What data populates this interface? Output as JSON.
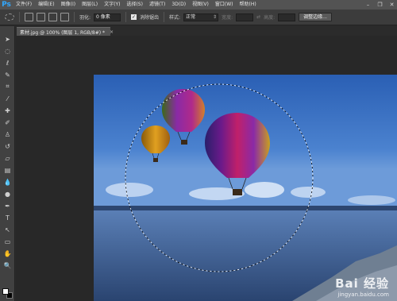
{
  "app": {
    "logo": "Ps"
  },
  "menu": {
    "items": [
      "文件(F)",
      "编辑(E)",
      "图像(I)",
      "图层(L)",
      "文字(Y)",
      "选择(S)",
      "滤镜(T)",
      "3D(D)",
      "视图(V)",
      "窗口(W)",
      "帮助(H)"
    ]
  },
  "window_controls": {
    "minimize": "–",
    "restore": "❐",
    "close": "✕"
  },
  "options": {
    "feather_label": "羽化:",
    "feather_value": "0 像素",
    "antialias_label": "消除锯齿",
    "antialias_checked": true,
    "style_label": "样式:",
    "style_value": "正常",
    "width_label": "宽度:",
    "height_label": "高度:",
    "refine_edge_button": "调整边缘..."
  },
  "document": {
    "tab_title": "素材.jpg @ 100% (图层 1, RGB/8#) *",
    "tab_close": "×"
  },
  "colors": {
    "foreground": "#ffffff",
    "background": "#000000",
    "accent": "#31a8ff"
  },
  "tools": [
    "move-tool-icon",
    "marquee-tool-icon",
    "lasso-tool-icon",
    "quick-select-tool-icon",
    "crop-tool-icon",
    "eyedropper-tool-icon",
    "healing-brush-tool-icon",
    "brush-tool-icon",
    "clone-stamp-tool-icon",
    "history-brush-tool-icon",
    "eraser-tool-icon",
    "gradient-tool-icon",
    "blur-tool-icon",
    "dodge-tool-icon",
    "pen-tool-icon",
    "type-tool-icon",
    "path-select-tool-icon",
    "shape-tool-icon",
    "hand-tool-icon",
    "zoom-tool-icon"
  ],
  "watermark": {
    "logo_text": "Bai 经验",
    "url": "jingyan.baidu.com"
  }
}
